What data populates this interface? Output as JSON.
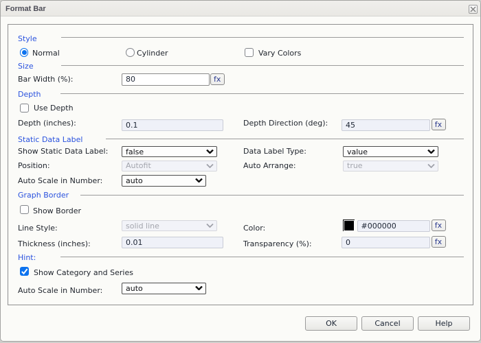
{
  "window": {
    "title": "Format Bar"
  },
  "style": {
    "header": "Style",
    "normal_label": "Normal",
    "cylinder_label": "Cylinder",
    "vary_colors_label": "Vary Colors"
  },
  "size": {
    "header": "Size",
    "bar_width_label": "Bar Width (%):",
    "bar_width_value": "80"
  },
  "depth": {
    "header": "Depth",
    "use_depth_label": "Use Depth",
    "depth_inches_label": "Depth (inches):",
    "depth_inches_value": "0.1",
    "direction_label": "Depth Direction (deg):",
    "direction_value": "45"
  },
  "static_data_label": {
    "header": "Static Data Label",
    "show_label": "Show Static Data Label:",
    "show_value": "false",
    "type_label": "Data Label Type:",
    "type_value": "value",
    "position_label": "Position:",
    "position_value": "Autofit",
    "arrange_label": "Auto Arrange:",
    "arrange_value": "true",
    "autoscale_label": "Auto Scale in Number:",
    "autoscale_value": "auto"
  },
  "graph_border": {
    "header": "Graph Border",
    "show_border_label": "Show Border",
    "line_style_label": "Line Style:",
    "line_style_value": "solid line",
    "color_label": "Color:",
    "color_value": "#000000",
    "swatch_color": "#000000",
    "thickness_label": "Thickness (inches):",
    "thickness_value": "0.01",
    "transparency_label": "Transparency (%):",
    "transparency_value": "0"
  },
  "hint": {
    "header": "Hint:",
    "show_category_label": "Show Category and Series",
    "autoscale_label": "Auto Scale in Number:",
    "autoscale_value": "auto"
  },
  "fx_label": "fx",
  "buttons": {
    "ok": "OK",
    "cancel": "Cancel",
    "help": "Help"
  },
  "colors": {
    "section_header": "#2a52de",
    "control_accent": "#0b76ec"
  }
}
